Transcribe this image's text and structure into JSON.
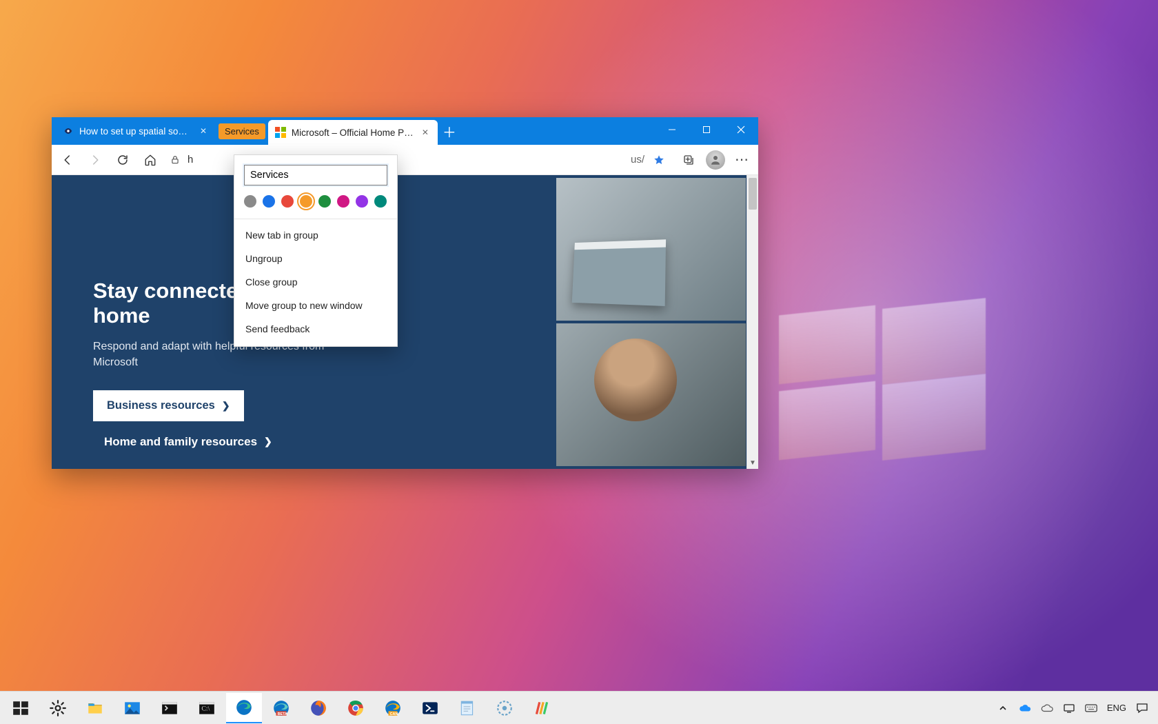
{
  "browser": {
    "tabs": [
      {
        "title": "How to set up spatial sound with",
        "favicon": "arrow",
        "active": false
      },
      {
        "title": "Microsoft – Official Home Page",
        "favicon": "ms",
        "active": true
      }
    ],
    "group_label": "Services",
    "window_controls": {
      "minimize": "—",
      "maximize": "▢",
      "close": "✕"
    },
    "toolbar": {
      "back": "←",
      "forward": "→",
      "refresh": "⟳",
      "home": "⌂",
      "lock": "🔒",
      "url_left": "h",
      "url_right": "us/",
      "favorite": "★",
      "collections": "⧉",
      "menu": "⋯"
    }
  },
  "page": {
    "heading_line1": "Stay connected at",
    "heading_line2": "home",
    "subheading": "Respond and adapt with helpful resources from Microsoft",
    "cta_primary": "Business resources",
    "cta_secondary": "Home and family resources"
  },
  "context_menu": {
    "name_value": "Services",
    "colors": [
      "#8a8a8a",
      "#1a73e8",
      "#e8483b",
      "#f59a29",
      "#1e8e3e",
      "#d01884",
      "#9334e6",
      "#00897b"
    ],
    "selected_color_index": 3,
    "items": [
      "New tab in group",
      "Ungroup",
      "Close group",
      "Move group to new window",
      "Send feedback"
    ]
  },
  "taskbar": {
    "tray_lang": "ENG"
  }
}
